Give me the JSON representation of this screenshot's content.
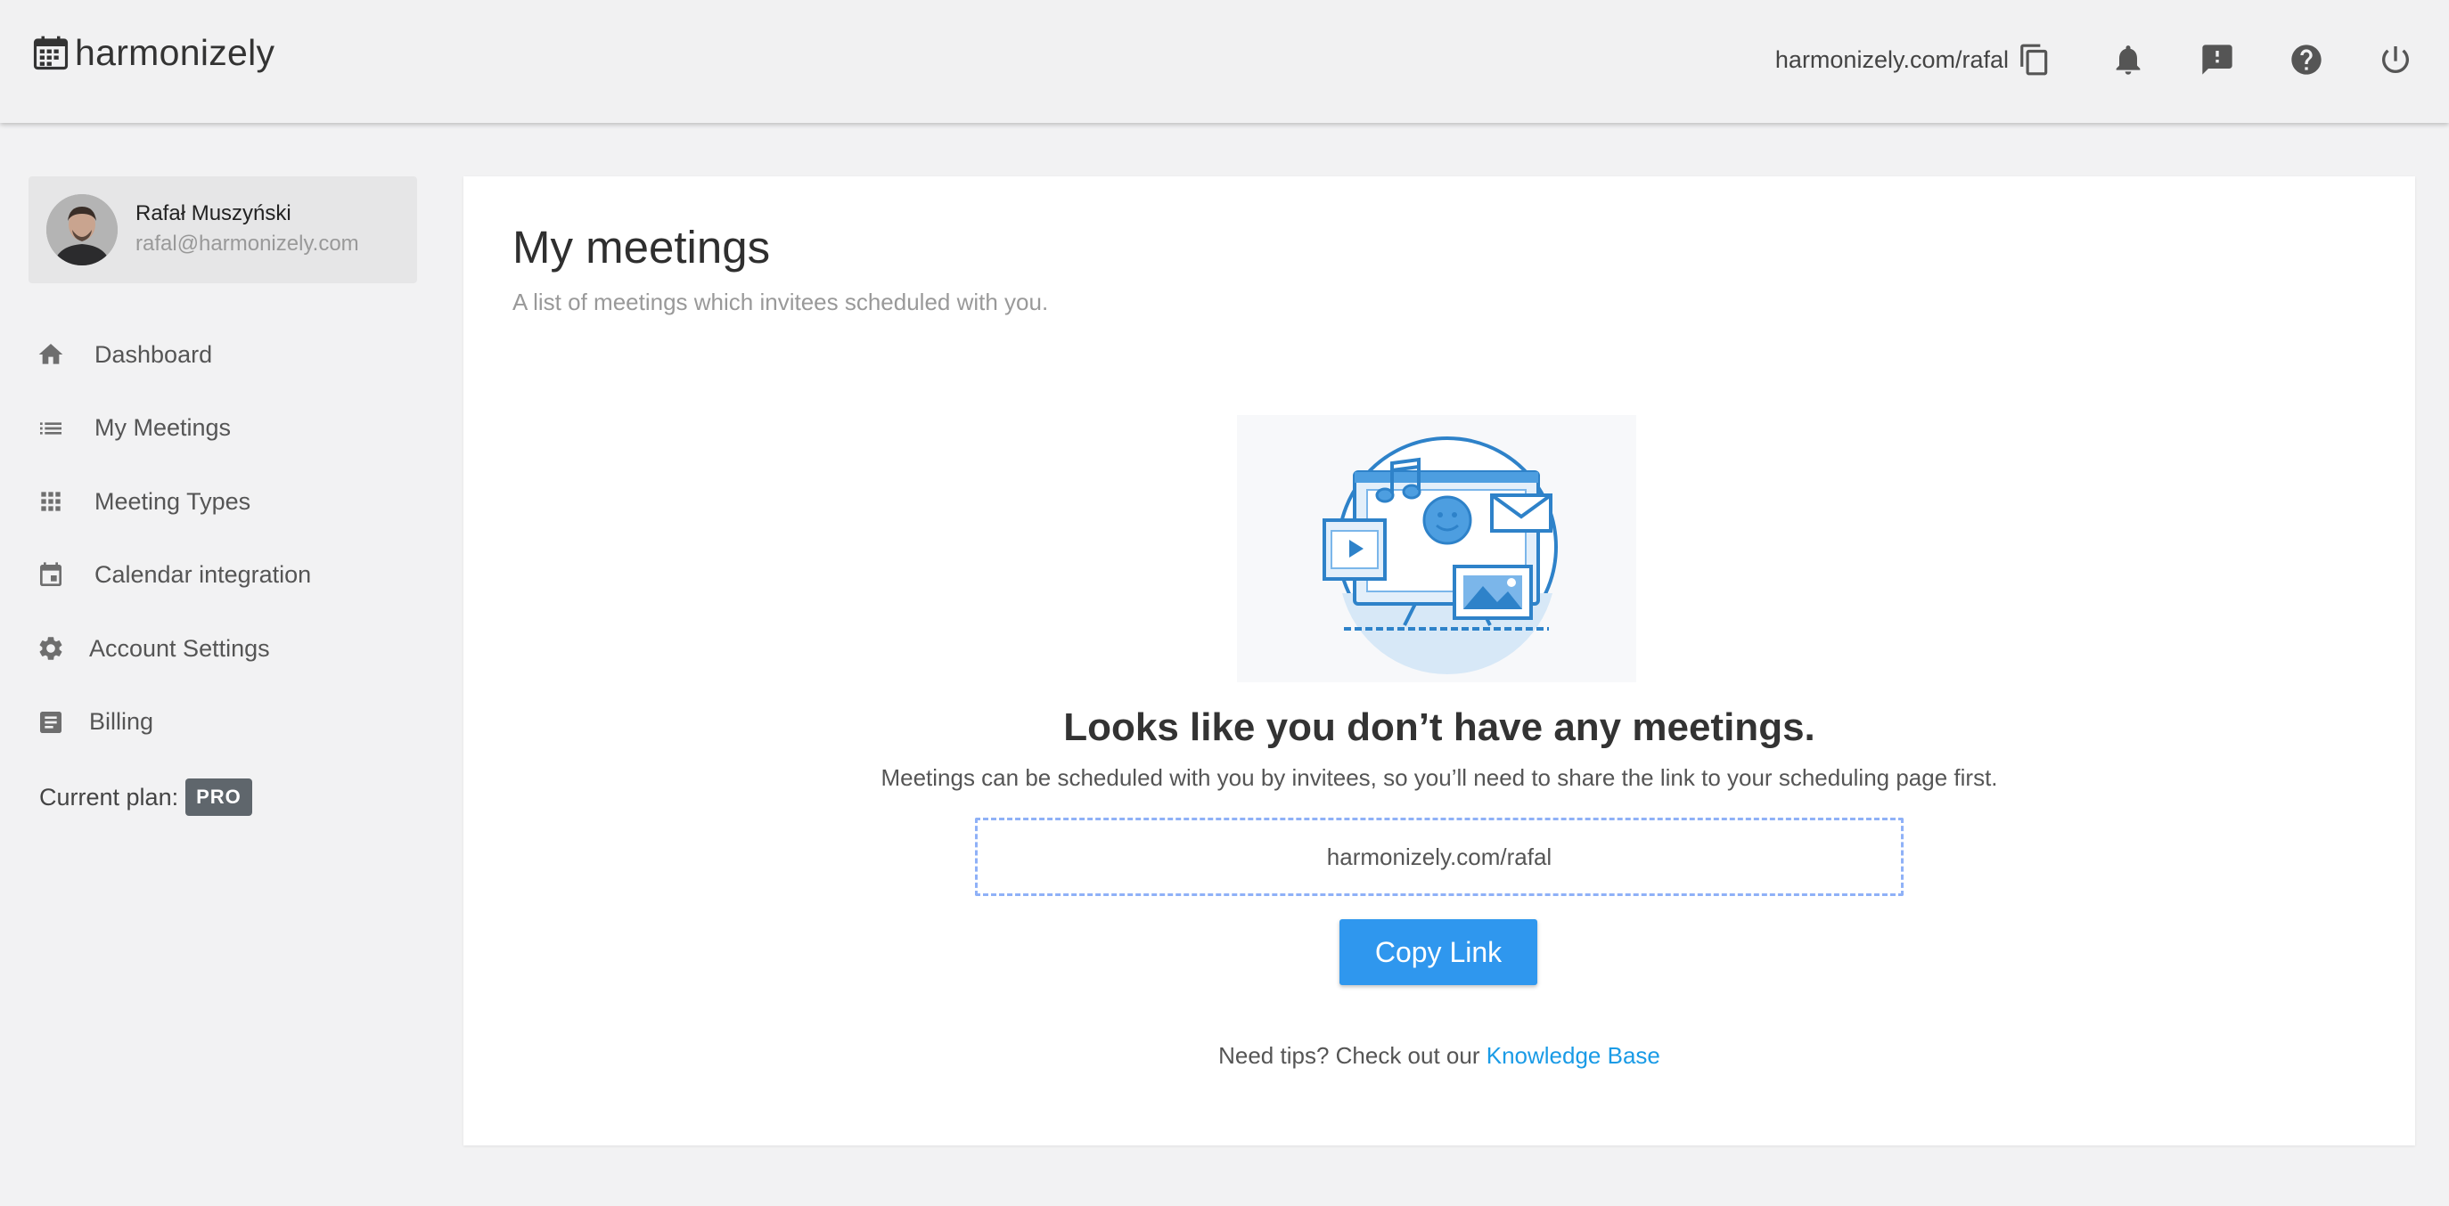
{
  "header": {
    "logo_text": "harmonizely",
    "logo_icon": "calendar-icon",
    "scheduling_link": "harmonizely.com/rafal",
    "icons": [
      "copy-icon",
      "bell-icon",
      "feedback-icon",
      "help-icon",
      "power-icon"
    ]
  },
  "profile": {
    "name": "Rafał Muszyński",
    "email": "rafal@harmonizely.com"
  },
  "sidebar": {
    "items": [
      {
        "label": "Dashboard",
        "icon": "home-icon"
      },
      {
        "label": "My Meetings",
        "icon": "list-icon"
      },
      {
        "label": "Meeting Types",
        "icon": "grid-icon"
      },
      {
        "label": "Calendar integration",
        "icon": "calendar-icon"
      },
      {
        "label": "Account Settings",
        "icon": "gear-icon"
      },
      {
        "label": "Billing",
        "icon": "billing-icon"
      }
    ],
    "plan_label": "Current plan:",
    "plan_badge": "PRO"
  },
  "main": {
    "title": "My meetings",
    "subtitle": "A list of meetings which invitees scheduled with you.",
    "empty_title": "Looks like you don’t have any meetings.",
    "empty_description": "Meetings can be scheduled with you by invitees, so you’ll need to share the link to your scheduling page first.",
    "link_value": "harmonizely.com/rafal",
    "copy_button": "Copy Link",
    "tips_text": "Need tips? Check out our ",
    "tips_link": "Knowledge Base"
  },
  "colors": {
    "accent": "#2f97ee",
    "link": "#1a9be6",
    "badge": "#5f666c",
    "dashed_border": "#8fb1f7"
  }
}
